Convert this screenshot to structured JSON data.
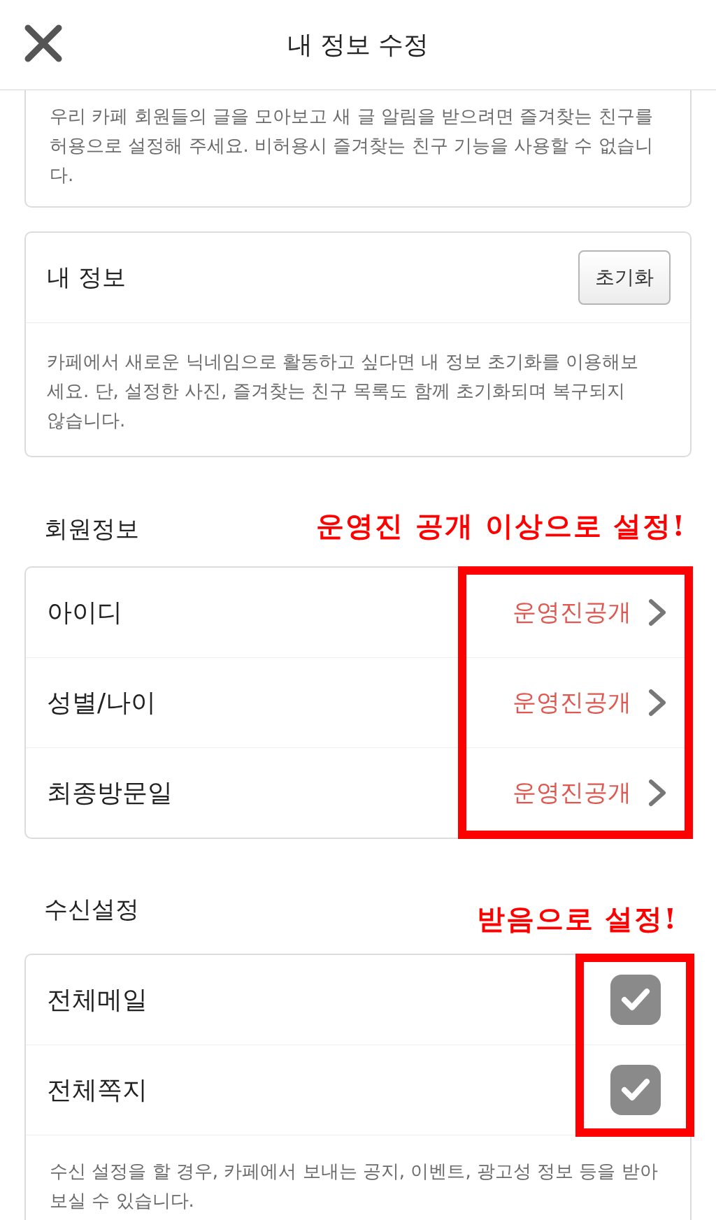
{
  "header": {
    "title": "내 정보 수정"
  },
  "notice": {
    "text": "우리 카페 회원들의 글을 모아보고 새 글 알림을 받으려면 즐겨찾는 친구를 허용으로 설정해 주세요. 비허용시 즐겨찾는 친구 기능을 사용할 수 없습니다."
  },
  "my_info": {
    "title": "내 정보",
    "reset_button": "초기화",
    "description": "카페에서 새로운 닉네임으로 활동하고 싶다면 내 정보 초기화를 이용해보세요. 단, 설정한 사진, 즐겨찾는 친구 목록도 함께 초기화되며 복구되지 않습니다."
  },
  "member_info": {
    "title": "회원정보",
    "annotation": "운영진 공개 이상으로 설정!",
    "rows": [
      {
        "label": "아이디",
        "value": "운영진공개"
      },
      {
        "label": "성별/나이",
        "value": "운영진공개"
      },
      {
        "label": "최종방문일",
        "value": "운영진공개"
      }
    ]
  },
  "receive_settings": {
    "title": "수신설정",
    "annotation": "받음으로 설정!",
    "rows": [
      {
        "label": "전체메일",
        "checked": true
      },
      {
        "label": "전체쪽지",
        "checked": true
      }
    ],
    "description": "수신 설정을 할 경우, 카페에서 보내는 공지, 이벤트, 광고성 정보 등을 받아보실 수 있습니다."
  }
}
